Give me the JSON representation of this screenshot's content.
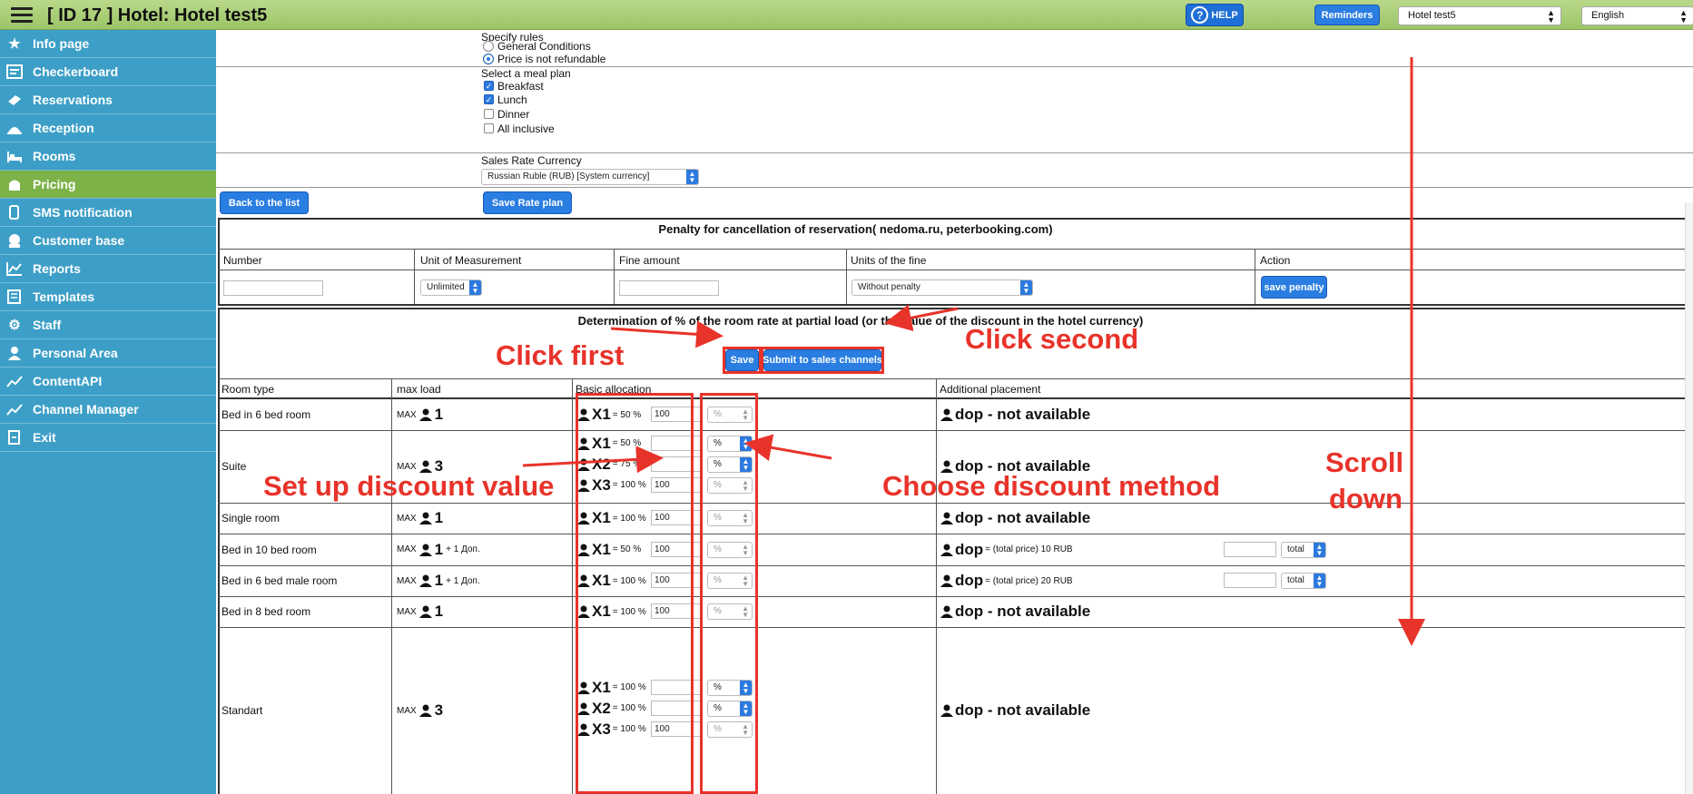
{
  "header": {
    "title": "[ ID 17 ] Hotel: Hotel test5",
    "help_label": "HELP",
    "reminders_label": "Reminders",
    "hotel_select": "Hotel test5",
    "language_select": "English"
  },
  "sidebar": {
    "items": [
      {
        "label": "Info page",
        "icon": "star-icon"
      },
      {
        "label": "Checkerboard",
        "icon": "checkerboard-icon"
      },
      {
        "label": "Reservations",
        "icon": "reservations-icon"
      },
      {
        "label": "Reception",
        "icon": "reception-bell-icon"
      },
      {
        "label": "Rooms",
        "icon": "bed-icon"
      },
      {
        "label": "Pricing",
        "icon": "pricing-icon",
        "active": true
      },
      {
        "label": "SMS notification",
        "icon": "sms-icon"
      },
      {
        "label": "Customer base",
        "icon": "customer-icon"
      },
      {
        "label": "Reports",
        "icon": "chart-icon"
      },
      {
        "label": "Templates",
        "icon": "template-icon"
      },
      {
        "label": "Staff",
        "icon": "gear-icon"
      },
      {
        "label": "Personal Area",
        "icon": "person-icon"
      },
      {
        "label": "ContentAPI",
        "icon": "api-icon"
      },
      {
        "label": "Channel Manager",
        "icon": "channel-icon"
      },
      {
        "label": "Exit",
        "icon": "exit-icon"
      }
    ]
  },
  "rules": {
    "label": "Specify rules",
    "option_general": "General Conditions",
    "option_nonref": "Price is not refundable",
    "selected": "Price is not refundable"
  },
  "meal": {
    "label": "Select a meal plan",
    "options": [
      {
        "label": "Breakfast",
        "checked": true
      },
      {
        "label": "Lunch",
        "checked": true
      },
      {
        "label": "Dinner",
        "checked": false
      },
      {
        "label": "All inclusive",
        "checked": false
      }
    ]
  },
  "currency": {
    "label": "Sales Rate Currency",
    "value": "Russian Ruble (RUB) [System currency]"
  },
  "buttons": {
    "back": "Back to the list",
    "save_rate": "Save Rate plan",
    "save_penalty": "save penalty",
    "save": "Save",
    "submit": "Submit to sales channels"
  },
  "penalty": {
    "title": "Penalty for cancellation of reservation( nedoma.ru, peterbooking.com)",
    "headers": [
      "Number",
      "Unit of Measurement",
      "Fine amount",
      "Units of the fine",
      "Action"
    ],
    "unit_value": "Unlimited",
    "fine_units_value": "Without penalty"
  },
  "partial": {
    "title": "Determination of % of the room rate at partial load (or the value of the discount in the hotel currency)",
    "headers": [
      "Room type",
      "max load",
      "Basic allocation",
      "Additional placement"
    ],
    "max_prefix": "MAX",
    "extra_text": "+ 1 Доп.",
    "dop_na": "dop - not available",
    "dop": "dop",
    "total_price": "= (total price)",
    "total_select": "total",
    "unit_select": "%",
    "rows": [
      {
        "room": "Bed in 6 bed room",
        "max": "1",
        "alloc": [
          {
            "x": "X1",
            "pct": "= 50 %",
            "val": "100"
          }
        ]
      },
      {
        "room": "Suite",
        "max": "3",
        "alloc": [
          {
            "x": "X1",
            "pct": "= 50 %",
            "val": ""
          },
          {
            "x": "X2",
            "pct": "= 75 %",
            "val": ""
          },
          {
            "x": "X3",
            "pct": "= 100 %",
            "val": "100"
          }
        ]
      },
      {
        "room": "Single room",
        "max": "1",
        "alloc": [
          {
            "x": "X1",
            "pct": "= 100 %",
            "val": "100"
          }
        ]
      },
      {
        "room": "Bed in 10 bed room",
        "max": "1",
        "alloc": [
          {
            "x": "X1",
            "pct": "= 50 %",
            "val": "100"
          }
        ],
        "dop_price": "10 RUB"
      },
      {
        "room": "Bed in 6 bed male room",
        "max": "1",
        "alloc": [
          {
            "x": "X1",
            "pct": "= 100 %",
            "val": "100"
          }
        ],
        "dop_price": "20 RUB"
      },
      {
        "room": "Bed in 8 bed room",
        "max": "1",
        "alloc": [
          {
            "x": "X1",
            "pct": "= 100 %",
            "val": "100"
          }
        ]
      },
      {
        "room": "Standart",
        "max": "3",
        "alloc": [
          {
            "x": "X1",
            "pct": "= 100 %",
            "val": ""
          },
          {
            "x": "X2",
            "pct": "= 100 %",
            "val": ""
          },
          {
            "x": "X3",
            "pct": "= 100 %",
            "val": "100"
          }
        ]
      }
    ]
  },
  "annotations": {
    "click_first": "Click first",
    "click_second": "Click second",
    "set_up": "Set up discount value",
    "choose": "Choose discount method",
    "scroll1": "Scroll",
    "scroll2": "down",
    "color": "#e8332a"
  }
}
